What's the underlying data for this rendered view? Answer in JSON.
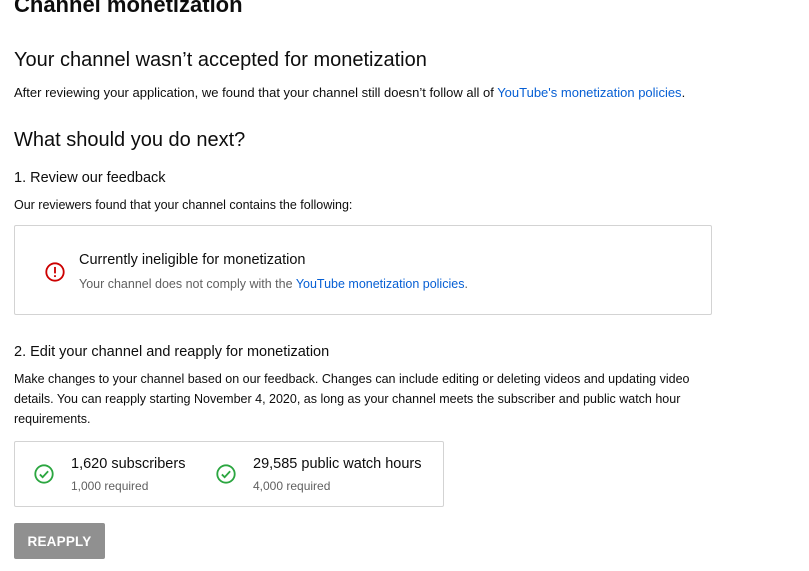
{
  "page": {
    "title": "Channel monetization"
  },
  "status": {
    "heading": "Your channel wasn’t accepted for monetization",
    "desc_prefix": "After reviewing your application, we found that your channel still doesn’t follow all of ",
    "desc_link": "YouTube's monetization policies",
    "desc_suffix": "."
  },
  "next_steps": {
    "heading": "What should you do next?",
    "step1": {
      "title": "1. Review our feedback",
      "desc": "Our reviewers found that your channel contains the following:",
      "card": {
        "title": "Currently ineligible for monetization",
        "desc_prefix": "Your channel does not comply with the ",
        "desc_link": "YouTube monetization policies",
        "desc_suffix": ".",
        "icon": "alert-circle-icon"
      }
    },
    "step2": {
      "title": "2. Edit your channel and reapply for monetization",
      "desc": "Make changes to your channel based on our feedback. Changes can include editing or deleting videos and updating video details. You can reapply starting November 4, 2020, as long as your channel meets the subscriber and public watch hour requirements.",
      "requirements": [
        {
          "value": "1,620 subscribers",
          "required": "1,000 required",
          "icon": "check-circle-icon"
        },
        {
          "value": "29,585 public watch hours",
          "required": "4,000 required",
          "icon": "check-circle-icon"
        }
      ]
    }
  },
  "actions": {
    "reapply_label": "REAPPLY"
  },
  "colors": {
    "link": "#065fd4",
    "error": "#cc0000",
    "success": "#2ba640",
    "button_disabled": "#909090"
  }
}
